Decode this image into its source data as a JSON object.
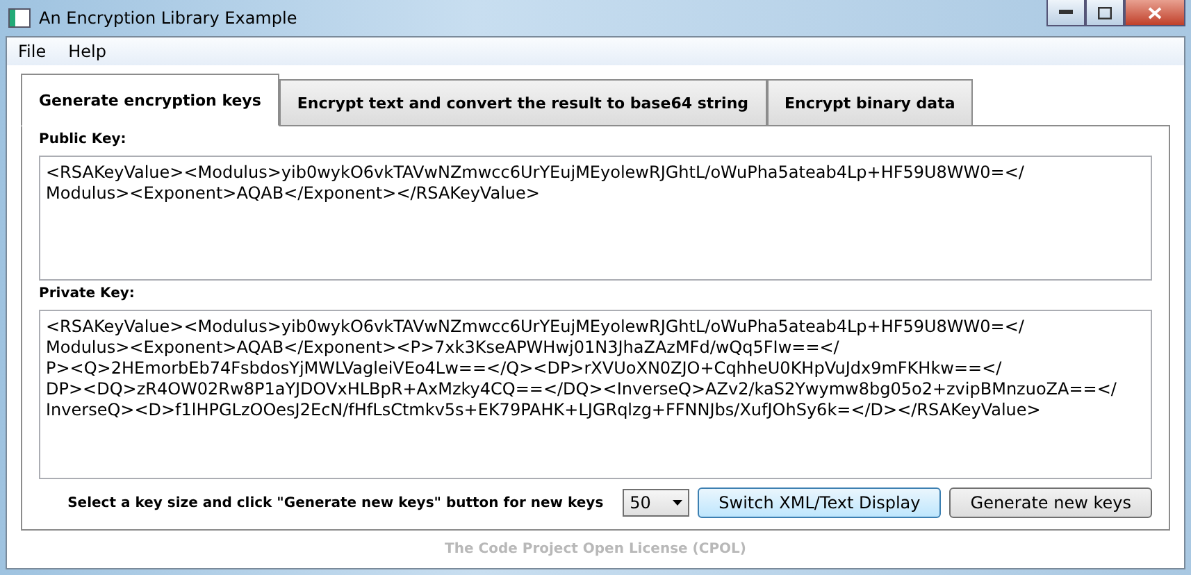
{
  "window": {
    "title": "An Encryption Library Example"
  },
  "menu": [
    "File",
    "Help"
  ],
  "tabs": [
    {
      "label": "Generate encryption keys",
      "selected": true
    },
    {
      "label": "Encrypt text and convert the result to base64 string",
      "selected": false
    },
    {
      "label": "Encrypt binary data",
      "selected": false
    }
  ],
  "public_key": {
    "label": "Public Key:",
    "lines": [
      "<RSAKeyValue><Modulus>yib0wykO6vkTAVwNZmwcc6UrYEujMEyolewRJGhtL/oWuPha5ateab4Lp+HF59U8WW0=</",
      "Modulus><Exponent>AQAB</Exponent></RSAKeyValue>"
    ]
  },
  "private_key": {
    "label": "Private Key:",
    "lines": [
      "<RSAKeyValue><Modulus>yib0wykO6vkTAVwNZmwcc6UrYEujMEyolewRJGhtL/oWuPha5ateab4Lp+HF59U8WW0=</",
      "Modulus><Exponent>AQAB</Exponent><P>7xk3KseAPWHwj01N3JhaZAzMFd/wQq5FIw==</",
      "P><Q>2HEmorbEb74FsbdosYjMWLVagleiVEo4Lw==</Q><DP>rXVUoXN0ZJO+CqhheU0KHpVuJdx9mFKHkw==</",
      "DP><DQ>zR4OW02Rw8P1aYJDOVxHLBpR+AxMzky4CQ==</DQ><InverseQ>AZv2/kaS2Ywymw8bg05o2+zvipBMnzuoZA==</",
      "InverseQ><D>f1lHPGLzOOesJ2EcN/fHfLsCtmkv5s+EK79PAHK+LJGRqlzg+FFNNJbs/XufJOhSy6k=</D></RSAKeyValue>"
    ]
  },
  "key_size": {
    "label": "Select a key size and click \"Generate new keys\" button for new keys",
    "value": "50"
  },
  "buttons": [
    "Switch XML/Text Display",
    "Generate new keys"
  ],
  "footer": "The Code Project Open License (CPOL)"
}
